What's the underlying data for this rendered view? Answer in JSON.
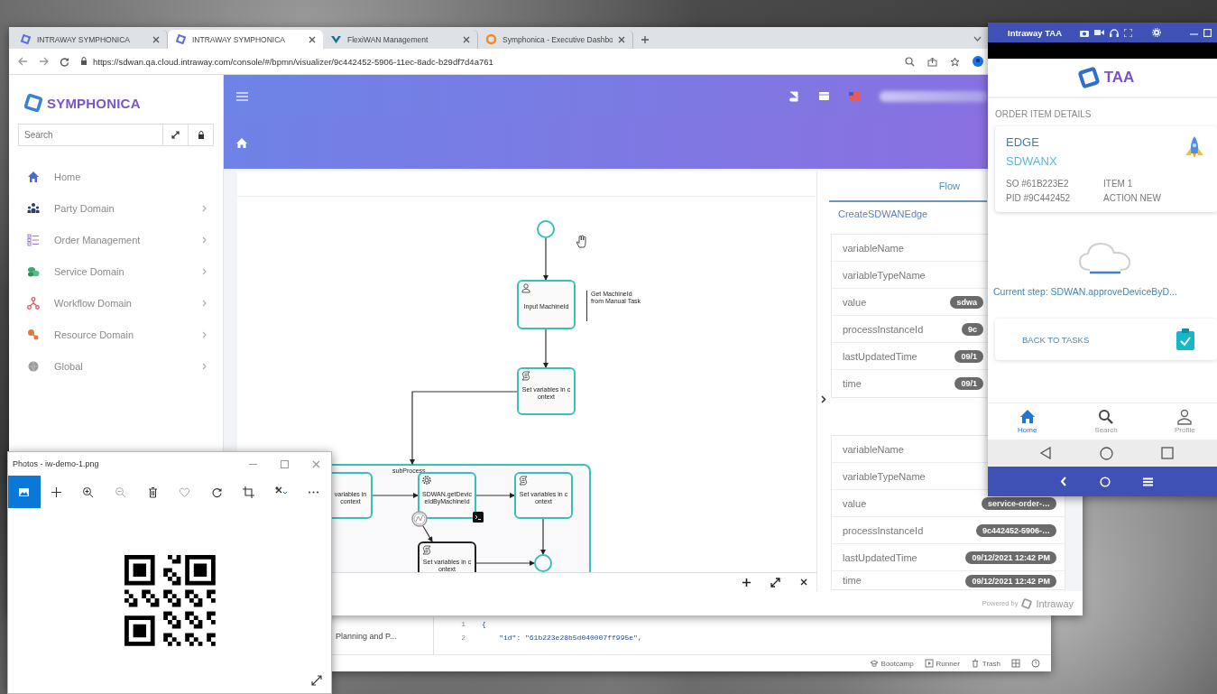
{
  "browser": {
    "tabs": [
      {
        "title": "INTRAWAY SYMPHONICA",
        "kind": "symphonica",
        "selected": false
      },
      {
        "title": "INTRAWAY SYMPHONICA",
        "kind": "symphonica",
        "selected": true
      },
      {
        "title": "FlexiWAN Management",
        "kind": "flexiwan",
        "selected": false
      },
      {
        "title": "Symphonica - Executive Dashbo",
        "kind": "dashboard",
        "selected": false
      }
    ],
    "url": "https://sdwan.qa.cloud.intraway.com/console/#/bpmn/visualizer/9c442452-5906-11ec-8adc-b29df7d4a761"
  },
  "app": {
    "logo": "SYMPHONICA",
    "search": {
      "placeholder": "Search"
    },
    "menu": [
      {
        "kind": "home",
        "label": "Home",
        "expandable": false
      },
      {
        "kind": "party",
        "label": "Party Domain",
        "expandable": true
      },
      {
        "kind": "order",
        "label": "Order Management",
        "expandable": true
      },
      {
        "kind": "service",
        "label": "Service Domain",
        "expandable": true
      },
      {
        "kind": "workflow",
        "label": "Workflow Domain",
        "expandable": true
      },
      {
        "kind": "resource",
        "label": "Resource Domain",
        "expandable": true
      },
      {
        "kind": "global",
        "label": "Global",
        "expandable": true
      }
    ],
    "diagram": {
      "nodes": [
        {
          "kind": "start_event",
          "completed": true
        },
        {
          "kind": "user_task",
          "label": "Input MachineId",
          "completed": true
        },
        {
          "kind": "annotation",
          "label": "Get MachineId from Manual Task"
        },
        {
          "kind": "script_task",
          "label": "Set variables in context",
          "completed": true
        },
        {
          "kind": "subprocess",
          "label": "subProcess",
          "completed": true
        },
        {
          "kind": "script_task",
          "label": "variables in context",
          "completed": true
        },
        {
          "kind": "service_task",
          "label": "SDWAN.getDeviceIdByMachineId",
          "completed": true
        },
        {
          "kind": "script_task",
          "label": "Set variables in context",
          "completed": true
        },
        {
          "kind": "script_task",
          "label": "Set variables in context",
          "completed": false
        },
        {
          "kind": "end_event",
          "completed": true
        },
        {
          "kind": "timer_event",
          "completed": false
        }
      ]
    },
    "flow_panel": {
      "tab": "Flow",
      "process": "CreateSDWANEdge",
      "groups": [
        {
          "rows": [
            {
              "name": "variableName"
            },
            {
              "name": "variableTypeName"
            },
            {
              "name": "value",
              "value": "sdwa"
            },
            {
              "name": "processInstanceId",
              "value": "9c"
            },
            {
              "name": "lastUpdatedTime",
              "value": "09/1"
            },
            {
              "name": "time",
              "value": "09/1"
            }
          ]
        },
        {
          "rows": [
            {
              "name": "variableName"
            },
            {
              "name": "variableTypeName"
            },
            {
              "name": "value",
              "value": "service-order-…"
            },
            {
              "name": "processInstanceId",
              "value": "9c442452-5906-…"
            },
            {
              "name": "lastUpdatedTime",
              "value": "09/12/2021 12:42 PM"
            },
            {
              "name": "time",
              "value": "09/12/2021 12:42 PM"
            }
          ]
        }
      ]
    },
    "footer": {
      "powered_by": "Powered by",
      "brand": "Intraway"
    }
  },
  "photos": {
    "title": "Photos - iw-demo-1.png",
    "toolbar": [
      {
        "kind": "view",
        "selected": true
      },
      {
        "kind": "add",
        "selected": false
      },
      {
        "kind": "zoom_in",
        "selected": false
      },
      {
        "kind": "zoom_out",
        "selected": false
      },
      {
        "kind": "delete",
        "selected": false
      },
      {
        "kind": "favorite",
        "selected": false
      },
      {
        "kind": "rotate",
        "selected": false
      },
      {
        "kind": "crop",
        "selected": false
      },
      {
        "kind": "edit",
        "selected": false
      },
      {
        "kind": "more",
        "selected": false
      }
    ]
  },
  "background_window": {
    "list_items": [
      "Planning and P..."
    ],
    "code_lines": [
      {
        "number": "1",
        "text": "{"
      },
      {
        "number": "2",
        "text": "    \"id\": \"61b223e28b5d040007ff995e\","
      }
    ],
    "status_items": [
      {
        "kind": "bootcamp",
        "label": "Bootcamp"
      },
      {
        "kind": "runner",
        "label": "Runner"
      },
      {
        "kind": "trash",
        "label": "Trash"
      }
    ]
  },
  "taa": {
    "title": "Intraway TAA",
    "logo": "TAA",
    "section": "ORDER ITEM DETAILS",
    "order": {
      "type": "EDGE",
      "name": "SDWANX",
      "so": "SO #61B223E2",
      "item": "ITEM 1",
      "pid": "PID #9C442452",
      "action": "ACTION NEW"
    },
    "current_step": "Current step: SDWAN.approveDeviceByD...",
    "back_button": "BACK TO TASKS",
    "nav": [
      {
        "kind": "home",
        "label": "Home",
        "selected": true
      },
      {
        "kind": "search",
        "label": "Search",
        "selected": false
      },
      {
        "kind": "profile",
        "label": "Profile",
        "selected": false
      }
    ]
  }
}
